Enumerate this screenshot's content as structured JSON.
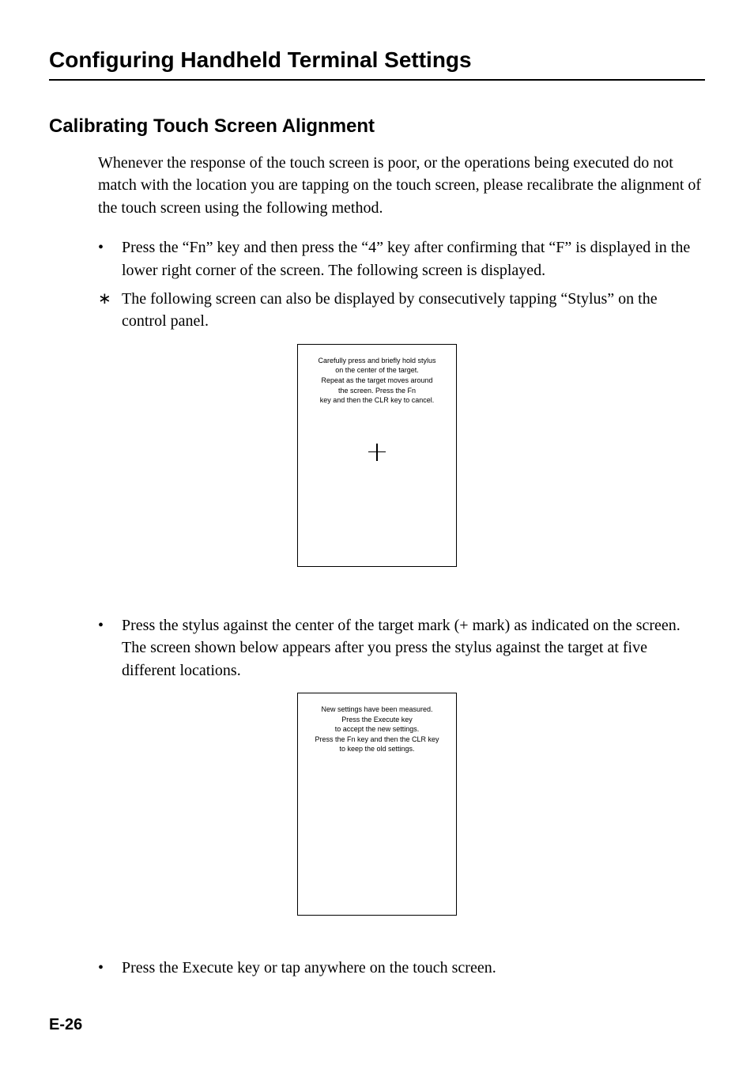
{
  "page_title": "Configuring Handheld Terminal Settings",
  "section_title": "Calibrating Touch Screen Alignment",
  "intro": "Whenever the response of the touch screen is poor, or the operations being executed do not match with the location you are tapping on the touch screen, please recalibrate the alignment of the touch screen using the following method.",
  "steps": {
    "s1": "Press the “Fn” key and then press the “4” key after confirming that “F” is displayed in the lower right corner of the screen.  The following screen is displayed.",
    "s2": "The following screen can also be displayed by consecutively tapping “Stylus” on the control panel.",
    "s3": "Press the stylus against the center of the target mark (+ mark) as indicated on the screen. The screen shown below appears after you press the stylus against the target at five different locations.",
    "s4": "Press the Execute key or tap anywhere on the touch screen."
  },
  "screen1": {
    "l1": "Carefully press and briefly hold stylus",
    "l2": "on the center of the target.",
    "l3": "Repeat as the target moves around",
    "l4": "the screen. Press the Fn",
    "l5": "key and then the CLR key to cancel."
  },
  "screen2": {
    "l1": "New settings have been measured.",
    "l2": "Press the Execute key",
    "l3": "to accept the new settings.",
    "l4": "Press the Fn key and then the CLR key",
    "l5": "to keep the old settings."
  },
  "page_number": "E-26"
}
